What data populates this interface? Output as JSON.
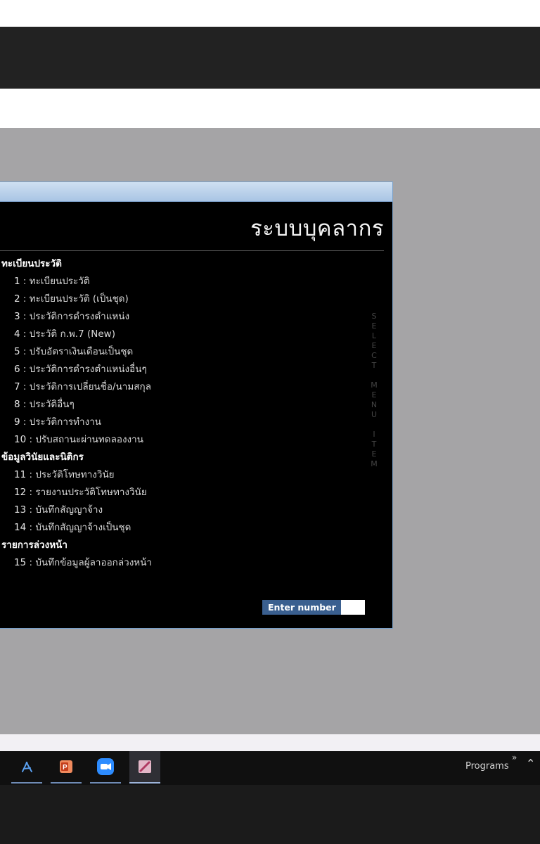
{
  "dialog": {
    "system_title": "ระบบบุคลากร",
    "vertical_caption": [
      "S",
      "E",
      "L",
      "E",
      "C",
      "T",
      "",
      "M",
      "E",
      "N",
      "U",
      "",
      "I",
      "T",
      "E",
      "M"
    ],
    "enter_label": "Enter number",
    "enter_value": ""
  },
  "menu": [
    {
      "type": "section",
      "label": "ทะเบียนประวัติ"
    },
    {
      "type": "item",
      "num": "1",
      "label": "ทะเบียนประวัติ"
    },
    {
      "type": "item",
      "num": "2",
      "label": "ทะเบียนประวัติ (เป็นชุด)"
    },
    {
      "type": "item",
      "num": "3",
      "label": "ประวัติการดำรงตำแหน่ง"
    },
    {
      "type": "item",
      "num": "4",
      "label": "ประวัติ ก.พ.7 (New)"
    },
    {
      "type": "item",
      "num": "5",
      "label": "ปรับอัตราเงินเดือนเป็นชุด"
    },
    {
      "type": "item",
      "num": "6",
      "label": "ประวัติการดำรงตำแหน่งอื่นๆ"
    },
    {
      "type": "item",
      "num": "7",
      "label": "ประวัติการเปลี่ยนชื่อ/นามสกุล"
    },
    {
      "type": "item",
      "num": "8",
      "label": "ประวัติอื่นๆ"
    },
    {
      "type": "item",
      "num": "9",
      "label": "ประวัติการทำงาน"
    },
    {
      "type": "item",
      "num": "10",
      "label": "ปรับสถานะผ่านทดลองงาน"
    },
    {
      "type": "section",
      "label": "ข้อมูลวินัยและนิติกร"
    },
    {
      "type": "item",
      "num": "11",
      "label": "ประวัติโทษทางวินัย"
    },
    {
      "type": "item",
      "num": "12",
      "label": "รายงานประวัติโทษทางวินัย"
    },
    {
      "type": "item",
      "num": "13",
      "label": "บันทึกสัญญาจ้าง"
    },
    {
      "type": "item",
      "num": "14",
      "label": "บันทึกสัญญาจ้างเป็นชุด"
    },
    {
      "type": "section",
      "label": "รายการล่วงหน้า"
    },
    {
      "type": "item",
      "num": "15",
      "label": "บันทึกข้อมูลผู้ลาออกล่วงหน้า"
    }
  ],
  "taskbar": {
    "apps": [
      {
        "icon": "pdf-reader-icon",
        "color": "#4a8ad8"
      },
      {
        "icon": "powerpoint-icon",
        "color": "#d35230"
      },
      {
        "icon": "zoom-icon",
        "color": "#2d8cff"
      },
      {
        "icon": "drawing-app-icon",
        "color": "#c2547a"
      }
    ],
    "programs_label": "Programs"
  },
  "colors": {
    "workspace": "#a5a4a6",
    "dialog_bg": "#000000",
    "titlebar": "#bcd3ec",
    "enter_label_bg": "#3a5f8f"
  }
}
